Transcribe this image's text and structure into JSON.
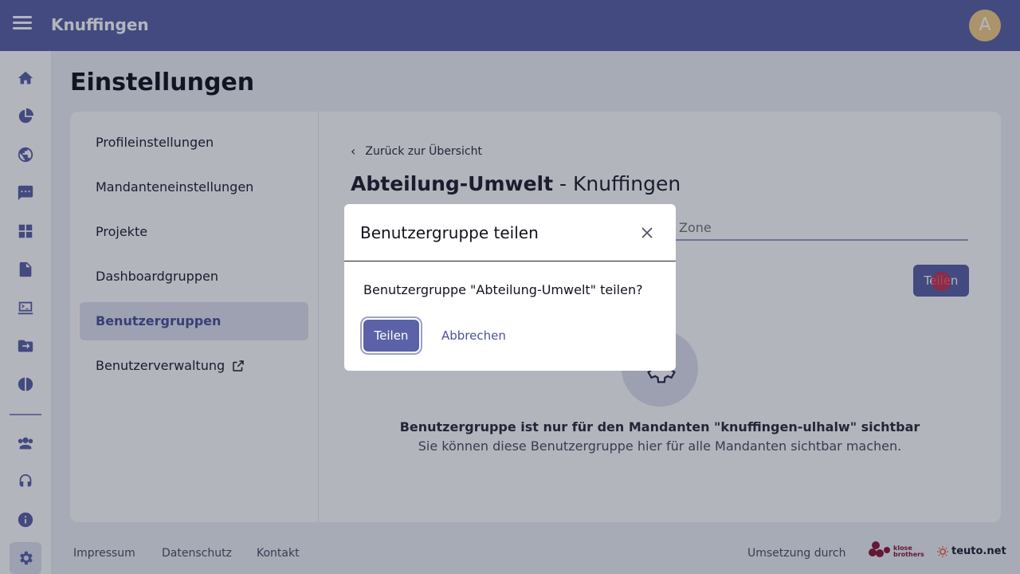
{
  "app": {
    "title": "Knuffingen",
    "avatar_letter": "A"
  },
  "rail": {
    "items": [
      {
        "name": "home-icon"
      },
      {
        "name": "pie-chart-icon"
      },
      {
        "name": "globe-icon"
      },
      {
        "name": "chat-icon"
      },
      {
        "name": "dashboard-icon"
      },
      {
        "name": "document-icon"
      },
      {
        "name": "terminal-icon"
      },
      {
        "name": "folder-icon"
      },
      {
        "name": "brain-icon"
      },
      {
        "name": "users-icon"
      },
      {
        "name": "support-icon"
      },
      {
        "name": "info-icon"
      },
      {
        "name": "settings-icon"
      }
    ],
    "active": "settings-icon"
  },
  "page": {
    "title": "Einstellungen"
  },
  "settings_nav": {
    "items": [
      {
        "label": "Profileinstellungen"
      },
      {
        "label": "Mandanteneinstellungen"
      },
      {
        "label": "Projekte"
      },
      {
        "label": "Dashboardgruppen"
      },
      {
        "label": "Benutzergruppen"
      },
      {
        "label": "Benutzerverwaltung"
      }
    ],
    "active_index": 4
  },
  "detail": {
    "back_label": "Zurück zur Übersicht",
    "title_bold": "Abteilung-Umwelt",
    "title_rest": " - Knuffingen",
    "zone_placeholder": "Zone",
    "share_button": "Teilen",
    "info_bold": "Benutzergruppe ist nur für den Mandanten \"knuffingen-ulhalw\" sichtbar",
    "info_sub": "Sie können diese Benutzergruppe hier für alle Mandanten sichtbar machen."
  },
  "footer": {
    "links": [
      "Impressum",
      "Datenschutz",
      "Kontakt"
    ],
    "credit": "Umsetzung durch",
    "logo_klose": "klose brothers",
    "logo_teuto": "teuto.net"
  },
  "dialog": {
    "title": "Benutzergruppe teilen",
    "message": "Benutzergruppe \"Abteilung-Umwelt\" teilen?",
    "confirm": "Teilen",
    "cancel": "Abbrechen"
  },
  "colors": {
    "accent": "#5b62a7",
    "accent_light": "#dfe2f1",
    "avatar": "#f3cf86"
  }
}
